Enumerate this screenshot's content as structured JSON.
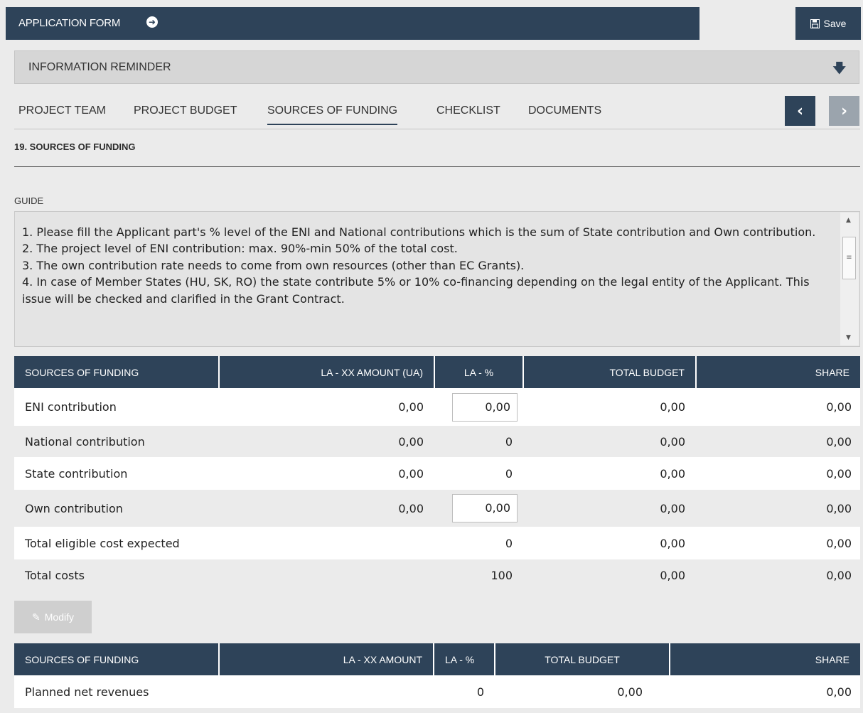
{
  "header": {
    "title": "APPLICATION FORM",
    "save_label": "Save"
  },
  "reminder": {
    "label": "INFORMATION REMINDER"
  },
  "tabs": [
    {
      "label": "PROJECT TEAM"
    },
    {
      "label": "PROJECT BUDGET"
    },
    {
      "label": "SOURCES OF FUNDING"
    },
    {
      "label": "CHECKLIST"
    },
    {
      "label": "DOCUMENTS"
    }
  ],
  "section": {
    "title": "19. SOURCES OF FUNDING",
    "guide_label": "GUIDE"
  },
  "guide_lines": [
    "1.    Please fill the Applicant part's % level of the ENI and National contributions which is the sum of State contribution and Own contribution.",
    "2.    The project level of ENI contribution: max. 90%-min 50% of the total cost.",
    "3.    The own contribution rate needs to come from own resources (other than EC Grants).",
    "4.    In case of Member States (HU, SK, RO) the state contribute 5% or 10% co-financing depending on the legal entity of the Applicant. This issue will be checked and clarified in the Grant Contract."
  ],
  "table1": {
    "headers": [
      "SOURCES OF FUNDING",
      "LA - XX AMOUNT (UA)",
      "LA - %",
      "TOTAL BUDGET",
      "SHARE"
    ],
    "rows": [
      {
        "name": "ENI contribution",
        "amount": "0,00",
        "pct": "0,00",
        "total": "0,00",
        "share": "0,00"
      },
      {
        "name": "National contribution",
        "amount": "0,00",
        "pct": "0",
        "total": "0,00",
        "share": "0,00"
      },
      {
        "name": "State contribution",
        "amount": "0,00",
        "pct": "0",
        "total": "0,00",
        "share": "0,00"
      },
      {
        "name": "Own contribution",
        "amount": "0,00",
        "pct": "0,00",
        "total": "0,00",
        "share": "0,00"
      },
      {
        "name": "Total eligible cost expected",
        "amount": "",
        "pct": "0",
        "total": "0,00",
        "share": "0,00"
      },
      {
        "name": "Total costs",
        "amount": "",
        "pct": "100",
        "total": "0,00",
        "share": "0,00"
      }
    ]
  },
  "modify_label": "Modify",
  "table2": {
    "headers": [
      "SOURCES OF FUNDING",
      "LA - XX AMOUNT",
      "LA - %",
      "TOTAL BUDGET",
      "SHARE"
    ],
    "rows": [
      {
        "name": "Planned net revenues",
        "amount": "",
        "pct": "0",
        "total": "0,00",
        "share": "0,00"
      }
    ]
  }
}
